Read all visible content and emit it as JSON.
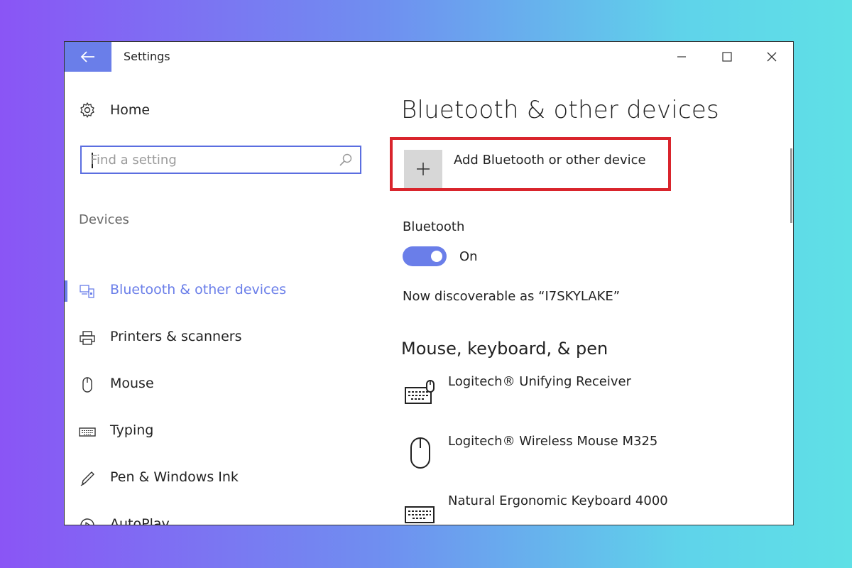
{
  "window": {
    "title": "Settings",
    "controls": {
      "minimize": "–",
      "maximize": "☐",
      "close": "✕"
    }
  },
  "sidebar": {
    "home_label": "Home",
    "search": {
      "placeholder": "Find a setting",
      "value": ""
    },
    "section_label": "Devices",
    "items": [
      {
        "label": "Bluetooth & other devices",
        "icon": "bluetooth-devices-icon",
        "active": true
      },
      {
        "label": "Printers & scanners",
        "icon": "printer-icon",
        "active": false
      },
      {
        "label": "Mouse",
        "icon": "mouse-icon",
        "active": false
      },
      {
        "label": "Typing",
        "icon": "keyboard-icon",
        "active": false
      },
      {
        "label": "Pen & Windows Ink",
        "icon": "pen-icon",
        "active": false
      },
      {
        "label": "AutoPlay",
        "icon": "autoplay-icon",
        "active": false
      }
    ]
  },
  "content": {
    "heading": "Bluetooth & other devices",
    "add_device_label": "Add Bluetooth or other device",
    "bluetooth_label": "Bluetooth",
    "bluetooth_state": "On",
    "discoverable_text": "Now discoverable as “I7SKYLAKE”",
    "section_heading": "Mouse, keyboard, & pen",
    "devices": [
      {
        "name": "Logitech® Unifying Receiver",
        "icon": "keyboard-mouse-icon"
      },
      {
        "name": "Logitech® Wireless Mouse M325",
        "icon": "mouse-icon"
      },
      {
        "name": "Natural Ergonomic Keyboard 4000",
        "icon": "keyboard-icon"
      }
    ]
  },
  "colors": {
    "accent": "#6a7ee9",
    "highlight_border": "#d9242c",
    "text": "#222222"
  }
}
